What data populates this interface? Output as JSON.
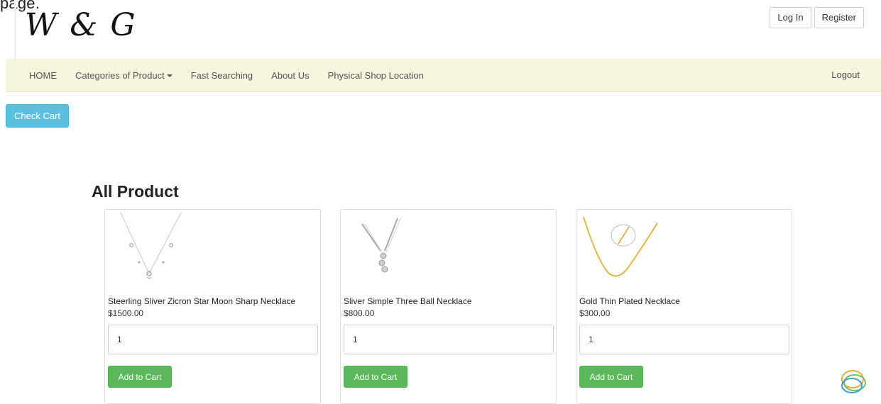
{
  "page_label": "page.",
  "brand": {
    "logo_text": "W & G"
  },
  "auth": {
    "login_label": "Log In",
    "register_label": "Register"
  },
  "nav": {
    "items": [
      {
        "label": "HOME"
      },
      {
        "label": "Categories of Product"
      },
      {
        "label": "Fast Searching"
      },
      {
        "label": "About Us"
      },
      {
        "label": "Physical Shop Location"
      }
    ],
    "logout_label": "Logout"
  },
  "cart": {
    "check_cart_label": "Check Cart"
  },
  "products_section": {
    "title": "All Product",
    "products": [
      {
        "name": "Steerling Sliver Zicron Star Moon Sharp Necklace",
        "price": "$1500.00",
        "quantity": "1",
        "add_label": "Add to Cart"
      },
      {
        "name": "Sliver Simple Three Ball Necklace",
        "price": "$800.00",
        "quantity": "1",
        "add_label": "Add to Cart"
      },
      {
        "name": "Gold Thin Plated Necklace",
        "price": "$300.00",
        "quantity": "1",
        "add_label": "Add to Cart"
      }
    ]
  },
  "colors": {
    "navbar_bg": "#f6f5dd",
    "info_button": "#5bc0de",
    "success_button": "#5cb85c"
  },
  "icons": {
    "chat_widget": "chat-bubbles-icon"
  }
}
